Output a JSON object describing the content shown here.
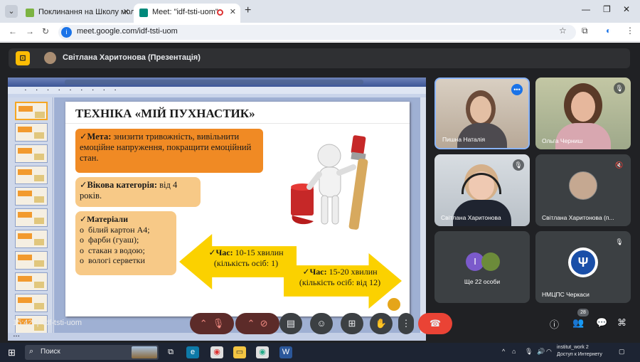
{
  "browser": {
    "tabs": [
      {
        "title": "Поклинання на Школу молод"
      },
      {
        "title": "Meet: \"idf-tsti-uom\""
      }
    ],
    "url": "meet.google.com/idf-tsti-uom"
  },
  "meet": {
    "presenter": "Світлана Харитонова (Презентація)",
    "meeting_code": "idf-tsti-uom",
    "time": "15:42",
    "people_count": "28",
    "participants": [
      {
        "name": "Пишна Наталія"
      },
      {
        "name": "Ольга Черниш"
      },
      {
        "name": "Світлана Харитонова"
      },
      {
        "name": "Світлана Харитонова (п..."
      },
      {
        "name": "Ще 22 особи"
      },
      {
        "name": "НМЦПС Черкаси"
      }
    ],
    "more_avatar_letter": "І"
  },
  "slide": {
    "title": "ТЕХНІКА «МІЙ ПУХНАСТИК»",
    "goal_label": "Мета:",
    "goal_text": " знизити тривожність, вивільнити емоційне напруження, покращити емоційний стан.",
    "age_label": "Вікова категорія:",
    "age_text": " від 4 років.",
    "materials_label": "Матеріали",
    "materials": [
      "білий картон А4;",
      "фарби (гуаш);",
      "стакан з водою;",
      "вологі серветки"
    ],
    "time1_label": "Час:",
    "time1_value": " 10-15 хвилин",
    "time1_people": "(кількість осіб: 1)",
    "time2_label": "Час:",
    "time2_value": " 15-20 хвилин",
    "time2_people": "(кількість осіб: від 12)"
  },
  "taskbar": {
    "search_placeholder": "Поиск",
    "network_name": "institut_work 2",
    "network_status": "Доступ к Интернету"
  }
}
